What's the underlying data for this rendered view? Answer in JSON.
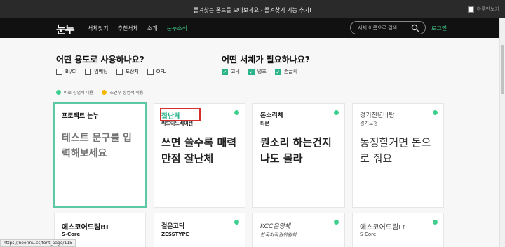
{
  "banner": {
    "message": "즐겨찾는 폰트를 모아보세요 - 즐겨찾기 기능 추가!",
    "hide_today": "하루만보기"
  },
  "nav": {
    "logo": "눈누",
    "menu": [
      "서체찾기",
      "추천서체",
      "소개",
      "눈누소식"
    ],
    "search_placeholder": "서체 이름으로 검색",
    "login": "로그인"
  },
  "filters": {
    "usage_title": "어떤 용도로 사용하나요?",
    "usage_options": [
      {
        "label": "BI/CI",
        "checked": false
      },
      {
        "label": "임베딩",
        "checked": false
      },
      {
        "label": "포장지",
        "checked": false
      },
      {
        "label": "OFL",
        "checked": false
      }
    ],
    "style_title": "어떤 서체가 필요하나요?",
    "style_options": [
      {
        "label": "고딕",
        "checked": true
      },
      {
        "label": "명조",
        "checked": true
      },
      {
        "label": "손글씨",
        "checked": true
      }
    ]
  },
  "legend": [
    {
      "label": "바로 상업적 이용",
      "color": "#3ecf8e"
    },
    {
      "label": "조건부 상업적 이용",
      "color": "#f5b800"
    }
  ],
  "cards": [
    {
      "name": "프로젝트 눈누",
      "preview_placeholder": "테스트 문구를 입력해보세요"
    },
    {
      "name": "잘난체",
      "maker": "위드이노베이션",
      "sample": "쓰면 쓸수록 매력만점 잘난체"
    },
    {
      "name": "돈소리체",
      "maker": "티몬",
      "sample": "뭔소리 하는건지 나도 몰라"
    },
    {
      "name": "경기천년바탕",
      "maker": "경기도청",
      "sample": "동정할거면 돈으로 줘요"
    },
    {
      "name": "에스코어드림BI",
      "maker": "S-Core"
    },
    {
      "name": "걸은고딕",
      "maker": "ZESSTYPE"
    },
    {
      "name": "KCC은영체",
      "maker": "한국저작권위원회"
    },
    {
      "name": "에스코어드림Lt",
      "maker": "S-Core"
    }
  ],
  "status_url": "https://noonnu.cc/font_page/115",
  "colors": {
    "accent": "#3ecf8e",
    "nav_bg": "#111111",
    "highlight": "#d32f2f"
  }
}
